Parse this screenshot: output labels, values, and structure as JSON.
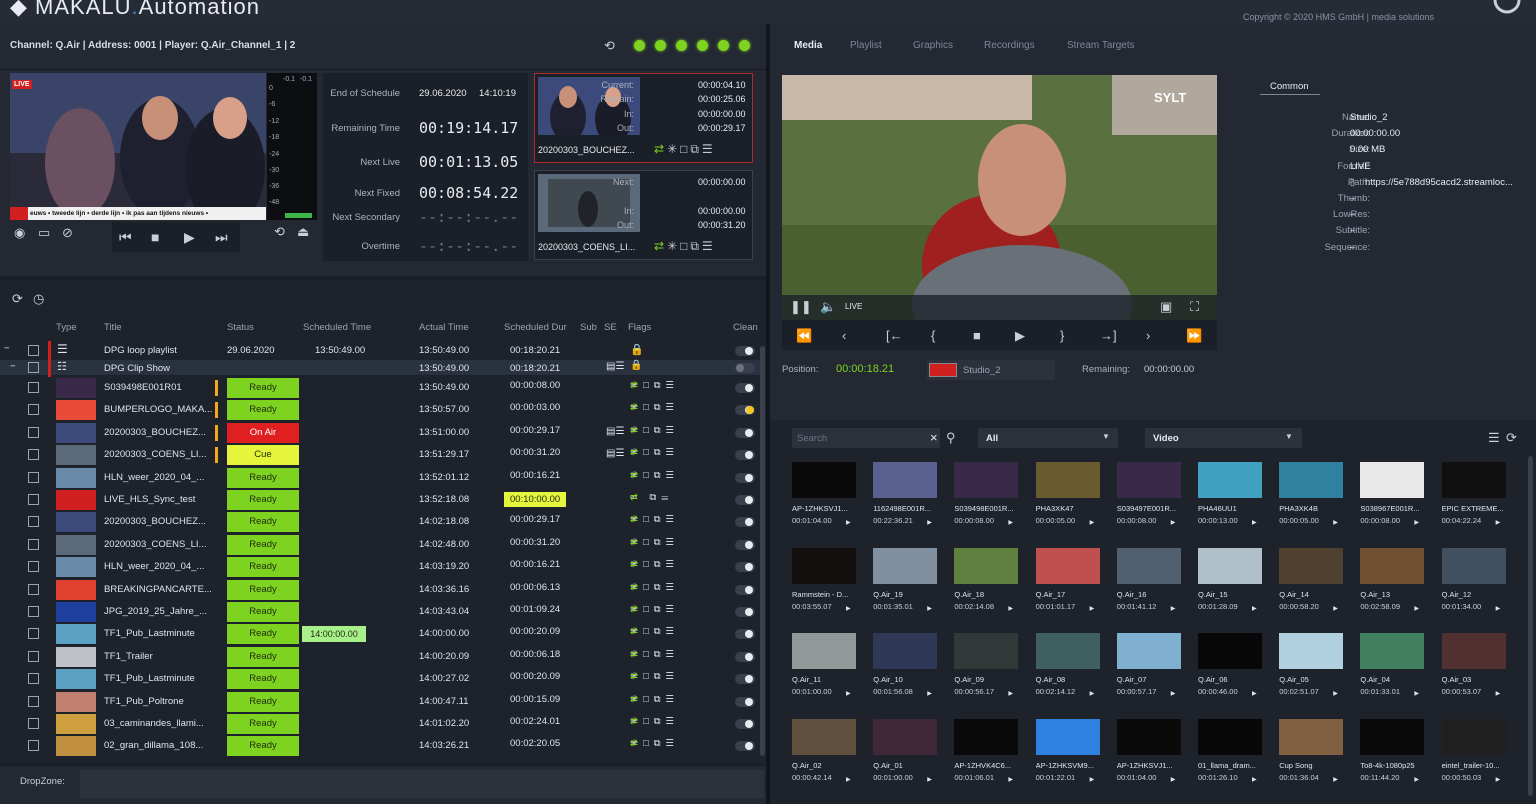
{
  "app": {
    "name_a": "MAKALU",
    "name_b": "Automation",
    "copyright": "Copyright © 2020 HMS GmbH | media solutions"
  },
  "channel_bar": {
    "info": "Channel: Q.Air | Address: 0001 | Player: Q.Air_Channel_1 | 2",
    "status_leds": [
      "#7ed321",
      "#7ed321",
      "#7ed321",
      "#7ed321",
      "#7ed321",
      "#7ed321"
    ]
  },
  "preview": {
    "live_badge": "LIVE",
    "ticker": "euws  •  tweede lijn  •  derde lijn  •  ik pas aan tijdens nieuws  •"
  },
  "meter": {
    "scale": [
      "0",
      "-6",
      "-12",
      "-18",
      "-24",
      "-30",
      "-36",
      "-48"
    ],
    "peak_l": "-0.1",
    "peak_r": "-0.1"
  },
  "schedule": {
    "end_of_schedule_label": "End of Schedule",
    "end_of_schedule_date": "29.06.2020",
    "end_of_schedule_time": "14:10:19",
    "remaining_label": "Remaining Time",
    "remaining_value": "00:19:14.17",
    "next_live_label": "Next Live",
    "next_live_value": "00:01:13.05",
    "next_fixed_label": "Next Fixed",
    "next_fixed_value": "00:08:54.22",
    "next_secondary_label": "Next Secondary",
    "next_secondary_value": "--:--:--.--",
    "overtime_label": "Overtime",
    "overtime_value": "--:--:--.--"
  },
  "current_clip": {
    "current_label": "Current:",
    "current": "00:00:04.10",
    "remain_label": "Remain:",
    "remain": "00:00:25.06",
    "in_label": "In:",
    "in": "00:00:00.00",
    "out_label": "Out:",
    "out": "00:00:29.17",
    "name": "20200303_BOUCHEZ..."
  },
  "next_clip": {
    "next_label": "Next:",
    "next": "00:00:00.00",
    "in_label": "In:",
    "in": "00:00:00.00",
    "out_label": "Out:",
    "out": "00:00:31.20",
    "name": "20200303_COENS_LI..."
  },
  "playlist": {
    "columns": {
      "type": "Type",
      "title": "Title",
      "status": "Status",
      "scheduled_time": "Scheduled Time",
      "actual_time": "Actual Time",
      "scheduled_dur": "Scheduled Dur",
      "sub": "Sub",
      "se": "SE",
      "flags": "Flags",
      "clean": "Clean"
    },
    "groups": [
      {
        "title": "DPG loop playlist",
        "status": "29.06.2020",
        "scheduled_time": "13:50:49.00",
        "actual_time": "13:50:49.00",
        "dur": "00:18:20.21"
      },
      {
        "title": "DPG Clip Show",
        "status": "",
        "scheduled_time": "",
        "actual_time": "13:50:49.00",
        "dur": "00:18:20.21"
      }
    ],
    "rows": [
      {
        "title": "S039498E001R01",
        "status": "Ready",
        "sched": "",
        "actual": "13:50:49.00",
        "dur": "00:00:08.00",
        "status_color": "#7ed321",
        "thumb": "#3a2a4a"
      },
      {
        "title": "BUMPERLOGO_MAKA...",
        "status": "Ready",
        "sched": "",
        "actual": "13:50:57.00",
        "dur": "00:00:03.00",
        "status_color": "#7ed321",
        "thumb": "#e84b3a"
      },
      {
        "title": "20200303_BOUCHEZ...",
        "status": "On Air",
        "sched": "",
        "actual": "13:51:00.00",
        "dur": "00:00:29.17",
        "status_color": "#e02020",
        "thumb": "#3b4a7a"
      },
      {
        "title": "20200303_COENS_LI...",
        "status": "Cue",
        "sched": "",
        "actual": "13:51:29.17",
        "dur": "00:00:31.20",
        "status_color": "#e4f53b",
        "thumb": "#5a6a7a"
      },
      {
        "title": "HLN_weer_2020_04_...",
        "status": "Ready",
        "sched": "",
        "actual": "13:52:01.12",
        "dur": "00:00:16.21",
        "status_color": "#7ed321",
        "thumb": "#6a8aaa"
      },
      {
        "title": "LIVE_HLS_Sync_test",
        "status": "Ready",
        "sched": "",
        "actual": "13:52:18.08",
        "dur": "00:10:00.00",
        "status_color": "#7ed321",
        "thumb": "#d02020"
      },
      {
        "title": "20200303_BOUCHEZ...",
        "status": "Ready",
        "sched": "",
        "actual": "14:02:18.08",
        "dur": "00:00:29.17",
        "status_color": "#7ed321",
        "thumb": "#3b4a7a"
      },
      {
        "title": "20200303_COENS_LI...",
        "status": "Ready",
        "sched": "",
        "actual": "14:02:48.00",
        "dur": "00:00:31.20",
        "status_color": "#7ed321",
        "thumb": "#5a6a7a"
      },
      {
        "title": "HLN_weer_2020_04_...",
        "status": "Ready",
        "sched": "",
        "actual": "14:03:19.20",
        "dur": "00:00:16.21",
        "status_color": "#7ed321",
        "thumb": "#6a8aaa"
      },
      {
        "title": "BREAKINGPANCARTE...",
        "status": "Ready",
        "sched": "",
        "actual": "14:03:36.16",
        "dur": "00:00:06.13",
        "status_color": "#7ed321",
        "thumb": "#e04030"
      },
      {
        "title": "JPG_2019_25_Jahre_...",
        "status": "Ready",
        "sched": "",
        "actual": "14:03:43.04",
        "dur": "00:01:09.24",
        "status_color": "#7ed321",
        "thumb": "#2040a0"
      },
      {
        "title": "TF1_Pub_Lastminute",
        "status": "Ready",
        "sched": "14:00:00.00",
        "actual": "14:00:00.00",
        "dur": "00:00:20.09",
        "status_color": "#7ed321",
        "thumb": "#5aa0c0"
      },
      {
        "title": "TF1_Trailer",
        "status": "Ready",
        "sched": "",
        "actual": "14:00:20.09",
        "dur": "00:00:06.18",
        "status_color": "#7ed321",
        "thumb": "#c0c0c8"
      },
      {
        "title": "TF1_Pub_Lastminute",
        "status": "Ready",
        "sched": "",
        "actual": "14:00:27.02",
        "dur": "00:00:20.09",
        "status_color": "#7ed321",
        "thumb": "#5aa0c0"
      },
      {
        "title": "TF1_Pub_Poltrone",
        "status": "Ready",
        "sched": "",
        "actual": "14:00:47.11",
        "dur": "00:00:15.09",
        "status_color": "#7ed321",
        "thumb": "#c08070"
      },
      {
        "title": "03_caminandes_llami...",
        "status": "Ready",
        "sched": "",
        "actual": "14:01:02.20",
        "dur": "00:02:24.01",
        "status_color": "#7ed321",
        "thumb": "#d0a040"
      },
      {
        "title": "02_gran_dillama_108...",
        "status": "Ready",
        "sched": "",
        "actual": "14:03:26.21",
        "dur": "00:02:20.05",
        "status_color": "#7ed321",
        "thumb": "#c09040"
      }
    ]
  },
  "dropzone": {
    "label": "DropZone:"
  },
  "right_tabs": [
    "Media",
    "Playlist",
    "Graphics",
    "Recordings",
    "Stream Targets"
  ],
  "player": {
    "live_label": "LIVE",
    "overlay": "SYLT",
    "position_label": "Position:",
    "position": "00:00:18.21",
    "clip_name": "Studio_2",
    "remaining_label": "Remaining:",
    "remaining": "00:00:00.00"
  },
  "properties": {
    "tab": "Common",
    "fields": [
      {
        "label": "Name:",
        "value": "Studio_2"
      },
      {
        "label": "Duration:",
        "value": "00:00:00.00"
      },
      {
        "label": "Size:",
        "value": "0.00 MB"
      },
      {
        "label": "Format:",
        "value": "LIVE"
      },
      {
        "label": "Path:",
        "value": "https://5e788d95cacd2.streamloc..."
      },
      {
        "label": "Thumb:",
        "value": "–"
      },
      {
        "label": "LowRes:",
        "value": "–"
      },
      {
        "label": "Subtitle:",
        "value": "–"
      },
      {
        "label": "Sequence:",
        "value": "–"
      }
    ]
  },
  "media_filter": {
    "search_placeholder": "Search",
    "category": "All",
    "type": "Video"
  },
  "media": [
    {
      "name": "AP-1ZHKSVJ1...",
      "dur": "00:01:04.00",
      "color": "#0a0a0a"
    },
    {
      "name": "1162498E001R...",
      "dur": "00:22:36.21",
      "color": "#5a6090"
    },
    {
      "name": "S039498E001R...",
      "dur": "00:00:08.00",
      "color": "#3a2a4a"
    },
    {
      "name": "PHA3XK47",
      "dur": "00:00:05.00",
      "color": "#6a5a30"
    },
    {
      "name": "S039497E001R...",
      "dur": "00:00:08.00",
      "color": "#3a2a4a"
    },
    {
      "name": "PHA46UU1",
      "dur": "00:00:13.00",
      "color": "#40a0c0"
    },
    {
      "name": "PHA3XK4B",
      "dur": "00:00:05.00",
      "color": "#3080a0"
    },
    {
      "name": "S038967E001R...",
      "dur": "00:00:08.00",
      "color": "#e8e8e8"
    },
    {
      "name": "EPIC EXTREME...",
      "dur": "00:04:22.24",
      "color": "#101010"
    },
    {
      "name": "Rammstein - D...",
      "dur": "00:03:55.07",
      "color": "#151010"
    },
    {
      "name": "Q.Air_19",
      "dur": "00:01:35.01",
      "color": "#8090a0"
    },
    {
      "name": "Q.Air_18",
      "dur": "00:02:14.08",
      "color": "#608040"
    },
    {
      "name": "Q.Air_17",
      "dur": "00:01:01.17",
      "color": "#c05050"
    },
    {
      "name": "Q.Air_16",
      "dur": "00:01:41.12",
      "color": "#506070"
    },
    {
      "name": "Q.Air_15",
      "dur": "00:01:28.09",
      "color": "#b0c0c8"
    },
    {
      "name": "Q.Air_14",
      "dur": "00:00:58.20",
      "color": "#504030"
    },
    {
      "name": "Q.Air_13",
      "dur": "00:02:58.09",
      "color": "#705030"
    },
    {
      "name": "Q.Air_12",
      "dur": "00:01:34.00",
      "color": "#405060"
    },
    {
      "name": "Q.Air_11",
      "dur": "00:01:00.00",
      "color": "#909898"
    },
    {
      "name": "Q.Air_10",
      "dur": "00:01:56.08",
      "color": "#303858"
    },
    {
      "name": "Q.Air_09",
      "dur": "00:00:56.17",
      "color": "#303838"
    },
    {
      "name": "Q.Air_08",
      "dur": "00:02:14.12",
      "color": "#406060"
    },
    {
      "name": "Q.Air_07",
      "dur": "00:00:57.17",
      "color": "#80b0d0"
    },
    {
      "name": "Q.Air_06",
      "dur": "00:00:46.00",
      "color": "#080808"
    },
    {
      "name": "Q.Air_05",
      "dur": "00:02:51.07",
      "color": "#b0d0e0"
    },
    {
      "name": "Q.Air_04",
      "dur": "00:01:33.01",
      "color": "#408060"
    },
    {
      "name": "Q.Air_03",
      "dur": "00:00:53.07",
      "color": "#503030"
    },
    {
      "name": "Q.Air_02",
      "dur": "00:00:42.14",
      "color": "#605040"
    },
    {
      "name": "Q.Air_01",
      "dur": "00:01:00.00",
      "color": "#402838"
    },
    {
      "name": "AP-1ZHVK4C6...",
      "dur": "00:01:06.01",
      "color": "#0a0a0a"
    },
    {
      "name": "AP-1ZHKSVM9...",
      "dur": "00:01:22.01",
      "color": "#3080e0"
    },
    {
      "name": "AP-1ZHKSVJ1...",
      "dur": "00:01:04.00",
      "color": "#0a0a0a"
    },
    {
      "name": "01_llama_dram...",
      "dur": "00:01:26.10",
      "color": "#080808"
    },
    {
      "name": "Cup Song",
      "dur": "00:01:36.04",
      "color": "#806040"
    },
    {
      "name": "To8-4k-1080p25",
      "dur": "00:11:44.20",
      "color": "#0a0a0a"
    },
    {
      "name": "eintel_trailer-10...",
      "dur": "00:00:50.03",
      "color": "#202020"
    }
  ]
}
